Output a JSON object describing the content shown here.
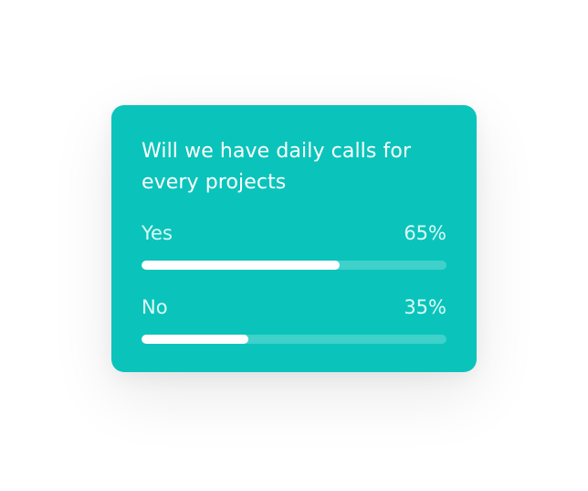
{
  "poll": {
    "question": "Will we have daily calls for every projects",
    "options": [
      {
        "label": "Yes",
        "percent_label": "65%",
        "fraction": 0.65
      },
      {
        "label": "No",
        "percent_label": "35%",
        "fraction": 0.35
      }
    ]
  },
  "colors": {
    "card_background": "#0ac4bb",
    "bar_fill": "#ffffff",
    "text": "#ffffff"
  }
}
